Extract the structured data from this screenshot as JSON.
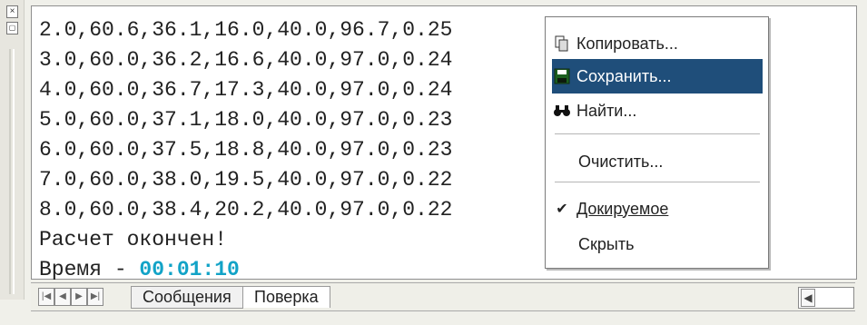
{
  "gripper": {
    "close_icon": "×"
  },
  "log": {
    "lines": [
      "2.0,60.6,36.1,16.0,40.0,96.7,0.25",
      "3.0,60.0,36.2,16.6,40.0,97.0,0.24",
      "4.0,60.0,36.7,17.3,40.0,97.0,0.24",
      "5.0,60.0,37.1,18.0,40.0,97.0,0.23",
      "6.0,60.0,37.5,18.8,40.0,97.0,0.23",
      "7.0,60.0,38.0,19.5,40.0,97.0,0.22",
      "8.0,60.0,38.4,20.2,40.0,97.0,0.22",
      "Расчет окончен!"
    ],
    "time_label": "Время - ",
    "time_value": "00:01:10"
  },
  "context_menu": {
    "items": [
      {
        "label": "Копировать...",
        "icon": "copy-icon",
        "selected": false
      },
      {
        "label": "Сохранить...",
        "icon": "save-icon",
        "selected": true
      },
      {
        "label": "Найти...",
        "icon": "binoculars-icon",
        "selected": false
      },
      {
        "label": "Очистить...",
        "icon": "",
        "selected": false
      },
      {
        "label": "Докируемое",
        "icon": "check-icon",
        "selected": false
      },
      {
        "label": "Скрыть",
        "icon": "",
        "selected": false
      }
    ]
  },
  "tabs": {
    "items": [
      "Сообщения",
      "Поверка"
    ],
    "active": "Поверка"
  },
  "colors": {
    "accent": "#1f4e7a",
    "time": "#12a3c7"
  }
}
